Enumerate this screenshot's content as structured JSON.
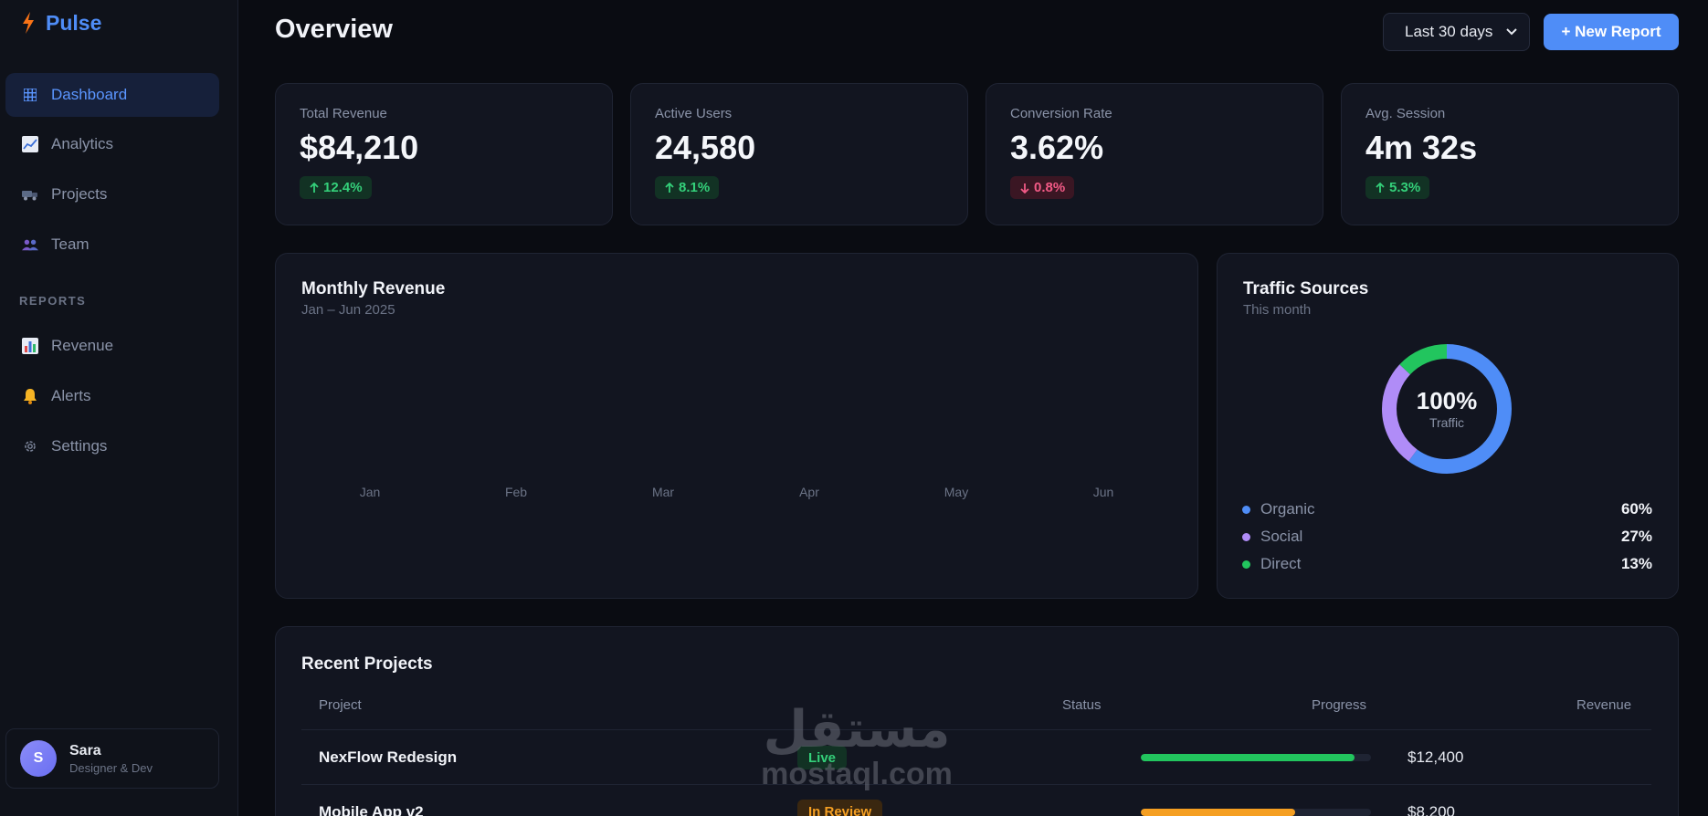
{
  "brand": {
    "name": "Pulse",
    "icon": "bolt-icon",
    "color": "#4f8df7"
  },
  "sidebar": {
    "items": [
      {
        "label": "Dashboard",
        "icon": "grid-icon",
        "active": true
      },
      {
        "label": "Analytics",
        "icon": "chart-line-icon"
      },
      {
        "label": "Projects",
        "icon": "truck-icon"
      },
      {
        "label": "Team",
        "icon": "people-icon"
      }
    ],
    "section_label": "REPORTS",
    "reports": [
      {
        "label": "Revenue",
        "icon": "bar-chart-icon"
      },
      {
        "label": "Alerts",
        "icon": "bell-icon"
      },
      {
        "label": "Settings",
        "icon": "gear-icon"
      }
    ],
    "user": {
      "initial": "S",
      "name": "Sara",
      "role": "Designer & Dev"
    }
  },
  "header": {
    "title": "Overview",
    "range": "Last 30 days",
    "new_report": "+ New Report"
  },
  "stats": [
    {
      "label": "Total Revenue",
      "value": "$84,210",
      "delta": "12.4%",
      "direction": "up"
    },
    {
      "label": "Active Users",
      "value": "24,580",
      "delta": "8.1%",
      "direction": "up"
    },
    {
      "label": "Conversion Rate",
      "value": "3.62%",
      "delta": "0.8%",
      "direction": "down"
    },
    {
      "label": "Avg. Session",
      "value": "4m 32s",
      "delta": "5.3%",
      "direction": "up"
    }
  ],
  "revenue_panel": {
    "title": "Monthly Revenue",
    "subtitle": "Jan – Jun 2025",
    "months": [
      "Jan",
      "Feb",
      "Mar",
      "Apr",
      "May",
      "Jun"
    ]
  },
  "traffic_panel": {
    "title": "Traffic Sources",
    "subtitle": "This month",
    "center_value": "100%",
    "center_label": "Traffic",
    "sources": [
      {
        "name": "Organic",
        "value": "60%",
        "share": 60,
        "color": "#4f8df7"
      },
      {
        "name": "Social",
        "value": "27%",
        "share": 27,
        "color": "#b08cf7"
      },
      {
        "name": "Direct",
        "value": "13%",
        "share": 13,
        "color": "#22c55e"
      }
    ]
  },
  "projects": {
    "title": "Recent Projects",
    "columns": [
      "Project",
      "Status",
      "Progress",
      "Revenue"
    ],
    "rows": [
      {
        "name": "NexFlow Redesign",
        "status": "Live",
        "status_kind": "live",
        "progress": 0.93,
        "progress_color": "#22c55e",
        "revenue": "$12,400"
      },
      {
        "name": "Mobile App v2",
        "status": "In Review",
        "status_kind": "review",
        "progress": 0.67,
        "progress_color": "#f59f22",
        "revenue": "$8,200"
      }
    ]
  },
  "watermark": {
    "arabic": "مستقل",
    "latin": "mostaql.com"
  }
}
